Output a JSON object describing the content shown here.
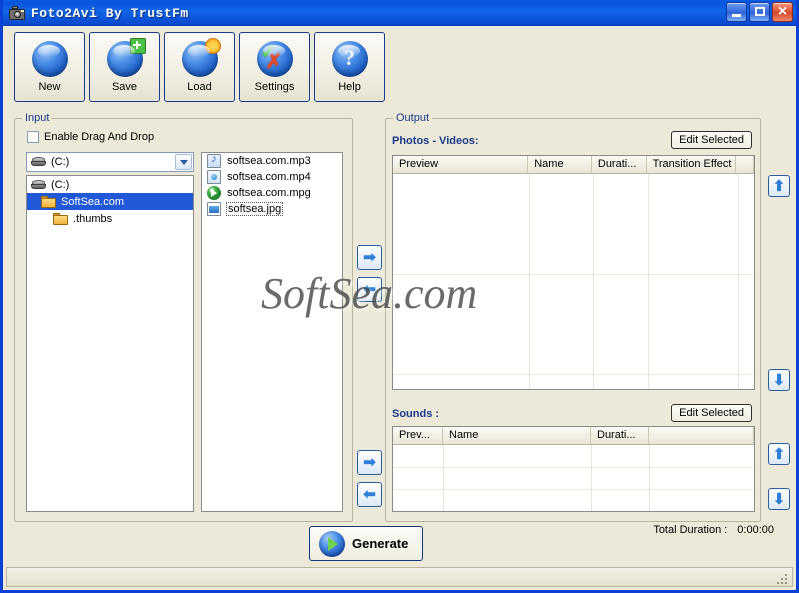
{
  "window": {
    "title": "Foto2Avi By TrustFm",
    "icon": "camera-icon",
    "minimize_label": "Minimize",
    "maximize_label": "Maximize",
    "close_label": "Close"
  },
  "toolbar": {
    "buttons": [
      {
        "label": "New",
        "icon": "blue-orb-icon"
      },
      {
        "label": "Save",
        "icon": "blue-orb-plus-icon"
      },
      {
        "label": "Load",
        "icon": "blue-orb-star-icon"
      },
      {
        "label": "Settings",
        "icon": "blue-orb-check-cross-icon"
      },
      {
        "label": "Help",
        "icon": "blue-orb-question-icon"
      }
    ]
  },
  "input": {
    "legend": "Input",
    "drag_drop_label": "Enable Drag And Drop",
    "drag_drop_checked": false,
    "drive_combo": {
      "value": "(C:)",
      "icon": "drive-icon"
    },
    "tree": [
      {
        "label": "(C:)",
        "icon": "drive-icon",
        "indent": 0,
        "selected": false
      },
      {
        "label": "SoftSea.com",
        "icon": "folder-icon",
        "indent": 1,
        "selected": true
      },
      {
        "label": ".thumbs",
        "icon": "folder-icon",
        "indent": 2,
        "selected": false
      }
    ],
    "files": [
      {
        "name": "softsea.com.mp3",
        "type": "mp3",
        "focused": false
      },
      {
        "name": "softsea.com.mp4",
        "type": "mp4",
        "focused": false
      },
      {
        "name": "softsea.com.mpg",
        "type": "mpg",
        "focused": false
      },
      {
        "name": "softsea.jpg",
        "type": "jpg",
        "focused": true
      }
    ]
  },
  "transfer": {
    "add_photos": "➡",
    "remove_photos": "⬅",
    "add_sounds": "➡",
    "remove_sounds": "⬅"
  },
  "output": {
    "legend": "Output",
    "photos_videos": {
      "title": "Photos - Videos:",
      "edit_label": "Edit Selected",
      "columns": [
        "Preview",
        "Name",
        "Durati...",
        "Transition Effect"
      ],
      "rows": [],
      "move_up": "⬆",
      "move_down": "⬇"
    },
    "sounds": {
      "title": "Sounds :",
      "edit_label": "Edit Selected",
      "columns": [
        "Prev...",
        "Name",
        "Durati..."
      ],
      "rows": [],
      "move_up": "⬆",
      "move_down": "⬇"
    }
  },
  "footer": {
    "generate_label": "Generate",
    "total_duration_label": "Total Duration :",
    "total_duration_value": "0:00:00"
  },
  "watermark": "SoftSea.com",
  "colors": {
    "title_bar": "#0a53dd",
    "window_border": "#0b41d6",
    "face": "#ece9d8",
    "selection": "#2158d8",
    "group_label": "#1b3a8f",
    "section_title": "#1b3a8f"
  }
}
